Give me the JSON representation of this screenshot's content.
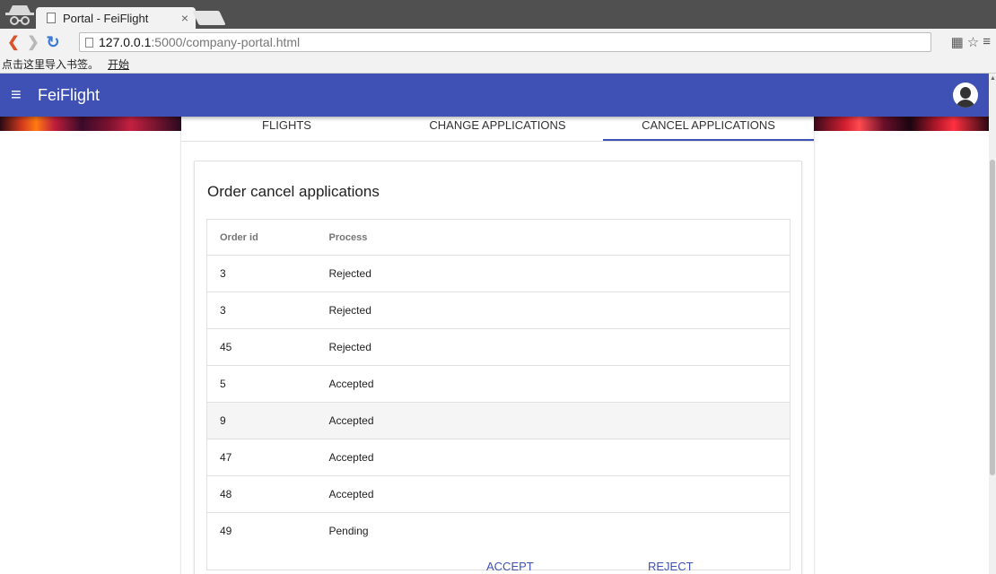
{
  "browser": {
    "tab_title": "Portal - FeiFlight",
    "tab_close": "×",
    "url_host": "127.0.0.1",
    "url_path": ":5000/company-portal.html",
    "bookmark_import": "点击这里导入书签。",
    "bookmark_start": "开始"
  },
  "app": {
    "brand": "FeiFlight",
    "menu_icon": "menu-icon"
  },
  "tabs": [
    {
      "label": "FLIGHTS"
    },
    {
      "label": "CHANGE APPLICATIONS"
    },
    {
      "label": "CANCEL APPLICATIONS",
      "active": true
    }
  ],
  "panel": {
    "title": "Order cancel applications",
    "columns": [
      "Order id",
      "Process"
    ],
    "rows": [
      {
        "order_id": "3",
        "process": "Rejected"
      },
      {
        "order_id": "3",
        "process": "Rejected"
      },
      {
        "order_id": "45",
        "process": "Rejected"
      },
      {
        "order_id": "5",
        "process": "Accepted"
      },
      {
        "order_id": "9",
        "process": "Accepted"
      },
      {
        "order_id": "47",
        "process": "Accepted"
      },
      {
        "order_id": "48",
        "process": "Accepted"
      },
      {
        "order_id": "49",
        "process": "Pending"
      }
    ]
  },
  "actions": {
    "accept_label": "ACCEPT",
    "reject_label": "REJECT"
  },
  "colors": {
    "primary": "#3f51b5",
    "highlight_row": "#f5f5f5"
  }
}
